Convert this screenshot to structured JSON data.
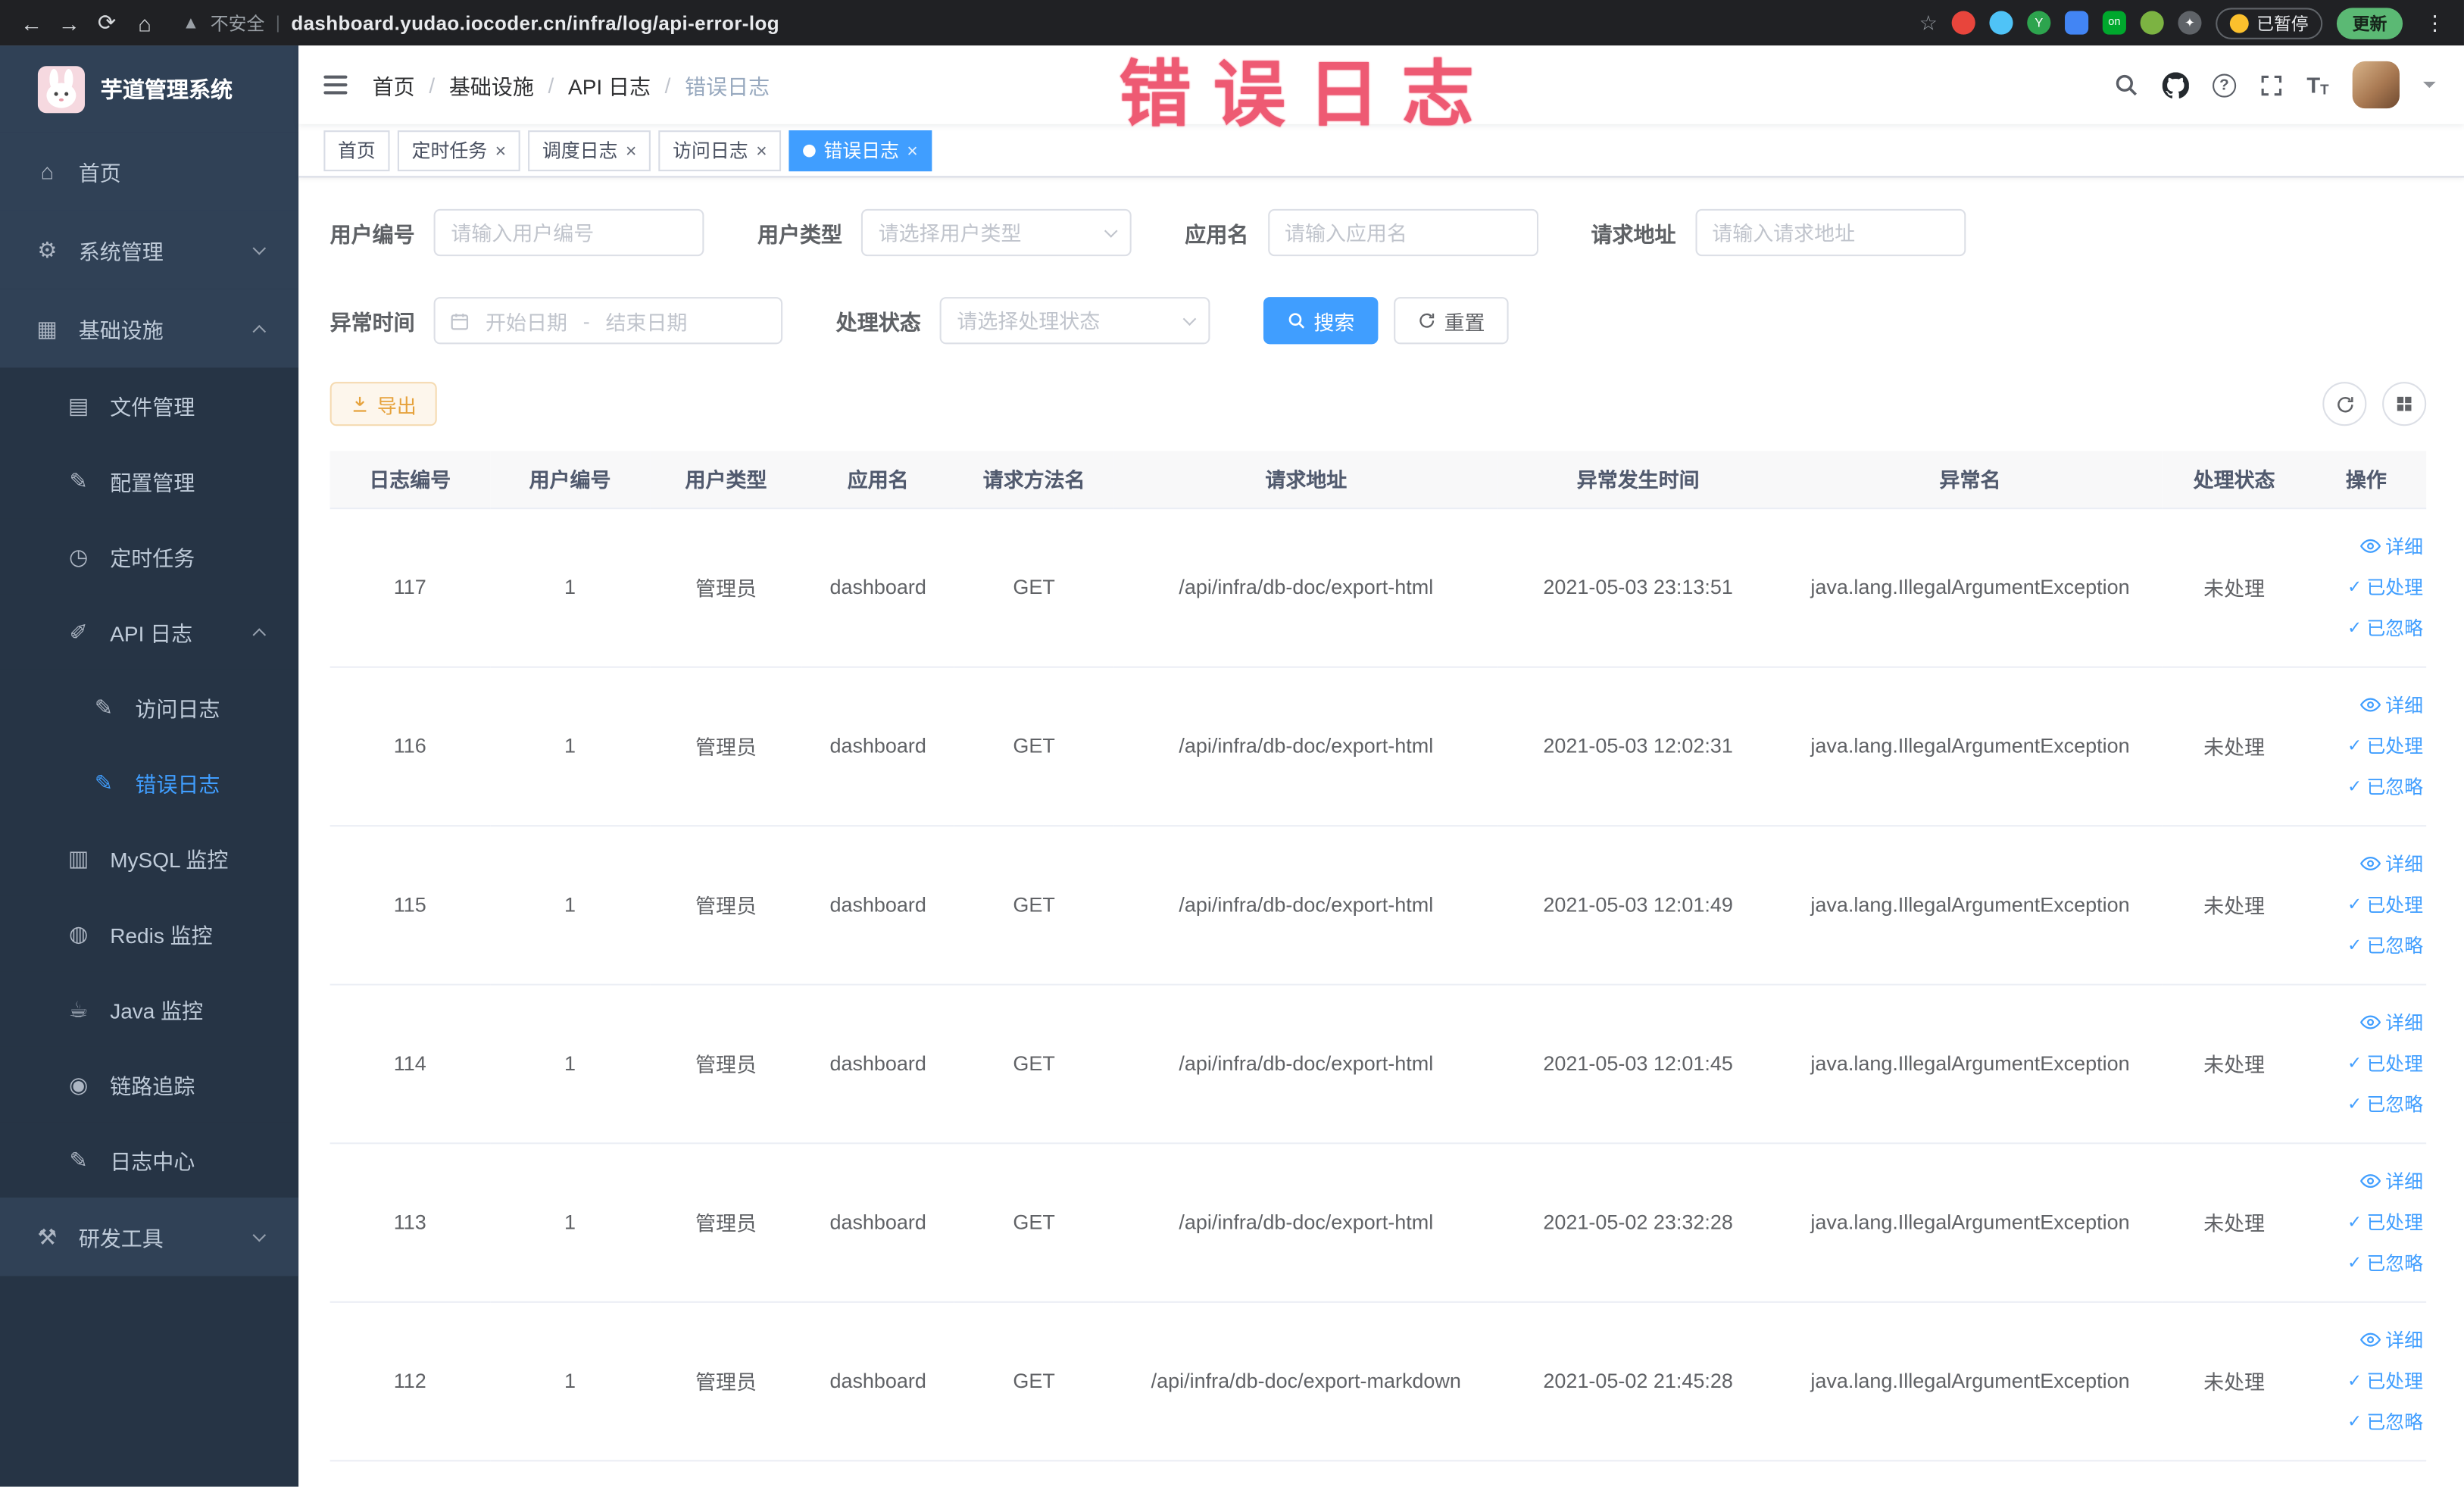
{
  "browser": {
    "security_text": "不安全",
    "url": "dashboard.yudao.iocoder.cn/infra/log/api-error-log",
    "paused_label": "已暂停",
    "update_label": "更新",
    "ext_on_label": "on",
    "ext_y_label": "Y"
  },
  "annotation_text": "错误日志",
  "sidebar": {
    "title": "芋道管理系统",
    "items": [
      {
        "label": "首页"
      },
      {
        "label": "系统管理"
      },
      {
        "label": "基础设施"
      },
      {
        "label": "文件管理"
      },
      {
        "label": "配置管理"
      },
      {
        "label": "定时任务"
      },
      {
        "label": "API 日志"
      },
      {
        "label": "访问日志"
      },
      {
        "label": "错误日志"
      },
      {
        "label": "MySQL 监控"
      },
      {
        "label": "Redis 监控"
      },
      {
        "label": "Java 监控"
      },
      {
        "label": "链路追踪"
      },
      {
        "label": "日志中心"
      },
      {
        "label": "研发工具"
      }
    ]
  },
  "breadcrumb": {
    "sep": "/",
    "items": [
      "首页",
      "基础设施",
      "API 日志",
      "错误日志"
    ]
  },
  "tags": {
    "items": [
      {
        "label": "首页"
      },
      {
        "label": "定时任务"
      },
      {
        "label": "调度日志"
      },
      {
        "label": "访问日志"
      },
      {
        "label": "错误日志"
      }
    ]
  },
  "filters": {
    "user_id_label": "用户编号",
    "user_id_placeholder": "请输入用户编号",
    "user_type_label": "用户类型",
    "user_type_placeholder": "请选择用户类型",
    "app_name_label": "应用名",
    "app_name_placeholder": "请输入应用名",
    "request_url_label": "请求地址",
    "request_url_placeholder": "请输入请求地址",
    "time_label": "异常时间",
    "start_placeholder": "开始日期",
    "separator": "-",
    "end_placeholder": "结束日期",
    "status_label": "处理状态",
    "status_placeholder": "请选择处理状态",
    "search_label": "搜索",
    "reset_label": "重置"
  },
  "toolbar": {
    "export_label": "导出"
  },
  "table": {
    "columns": [
      "日志编号",
      "用户编号",
      "用户类型",
      "应用名",
      "请求方法名",
      "请求地址",
      "异常发生时间",
      "异常名",
      "处理状态",
      "操作"
    ],
    "actions": {
      "detail": "详细",
      "processed": "已处理",
      "ignored": "已忽略"
    },
    "rows": [
      {
        "id": "117",
        "user_id": "1",
        "user_type": "管理员",
        "app_name": "dashboard",
        "method": "GET",
        "url": "/api/infra/db-doc/export-html",
        "time": "2021-05-03 23:13:51",
        "exception": "java.lang.IllegalArgumentException",
        "status": "未处理"
      },
      {
        "id": "116",
        "user_id": "1",
        "user_type": "管理员",
        "app_name": "dashboard",
        "method": "GET",
        "url": "/api/infra/db-doc/export-html",
        "time": "2021-05-03 12:02:31",
        "exception": "java.lang.IllegalArgumentException",
        "status": "未处理"
      },
      {
        "id": "115",
        "user_id": "1",
        "user_type": "管理员",
        "app_name": "dashboard",
        "method": "GET",
        "url": "/api/infra/db-doc/export-html",
        "time": "2021-05-03 12:01:49",
        "exception": "java.lang.IllegalArgumentException",
        "status": "未处理"
      },
      {
        "id": "114",
        "user_id": "1",
        "user_type": "管理员",
        "app_name": "dashboard",
        "method": "GET",
        "url": "/api/infra/db-doc/export-html",
        "time": "2021-05-03 12:01:45",
        "exception": "java.lang.IllegalArgumentException",
        "status": "未处理"
      },
      {
        "id": "113",
        "user_id": "1",
        "user_type": "管理员",
        "app_name": "dashboard",
        "method": "GET",
        "url": "/api/infra/db-doc/export-html",
        "time": "2021-05-02 23:32:28",
        "exception": "java.lang.IllegalArgumentException",
        "status": "未处理"
      },
      {
        "id": "112",
        "user_id": "1",
        "user_type": "管理员",
        "app_name": "dashboard",
        "method": "GET",
        "url": "/api/infra/db-doc/export-markdown",
        "time": "2021-05-02 21:45:28",
        "exception": "java.lang.IllegalArgumentException",
        "status": "未处理"
      }
    ]
  }
}
